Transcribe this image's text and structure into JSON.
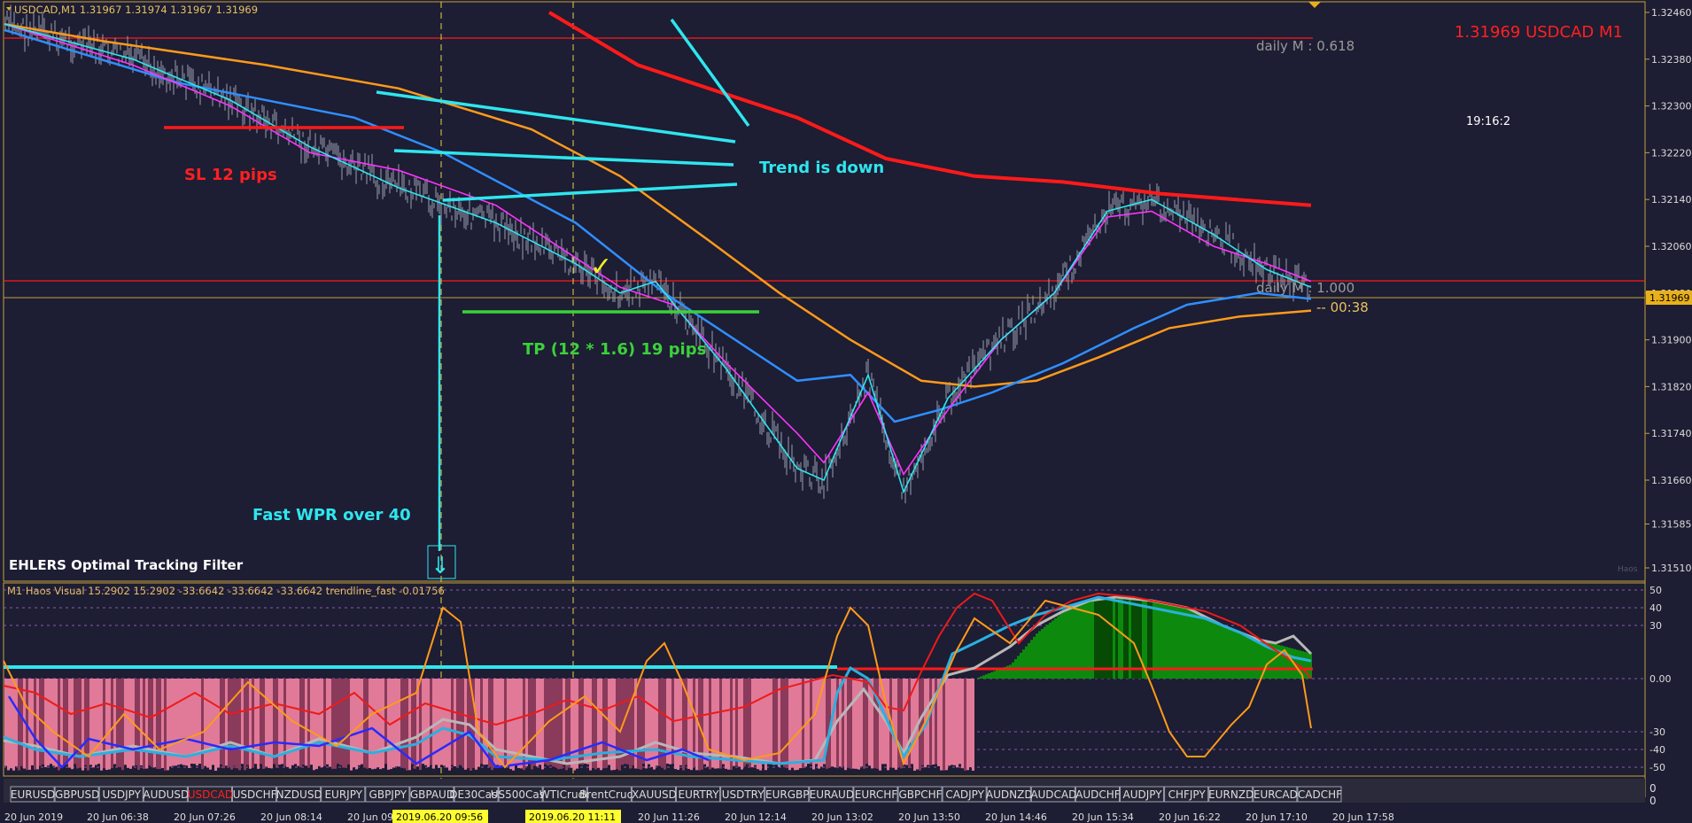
{
  "window": {
    "header": "USDCAD,M1  1.31967 1.31974 1.31967 1.31969",
    "symbol_price": "1.31969 USDCAD M1",
    "clock": "19:16:2"
  },
  "colors": {
    "background": "#1d1d33",
    "frame": "#c8a13b",
    "price_text": "#ff2020",
    "cyan": "#2ee6ee",
    "red_line": "#ff1a1a",
    "orange": "#ff9a1a",
    "blue": "#2f8fff",
    "magenta": "#ff33ff",
    "green_label": "#3bd13b",
    "pink_hist": "#e07a98",
    "green_hist": "#0d8a0d"
  },
  "price_axis": {
    "ticks": [
      "1.32460",
      "1.32380",
      "1.32300",
      "1.32220",
      "1.32140",
      "1.32060",
      "1.31980",
      "1.31900",
      "1.31820",
      "1.31740",
      "1.31660",
      "1.31585",
      "1.31510"
    ],
    "current": "1.31969"
  },
  "annotations": {
    "sl": "SL 12 pips",
    "trend": "Trend is down",
    "tp": "TP (12 * 1.6) 19 pips",
    "wpr": "Fast WPR over 40",
    "checkmark": "✓",
    "ehlers": "EHLERS Optimal Tracking Filter",
    "daily_m": "daily M : 0.618",
    "daily_1": "daily M : 1.000",
    "countdown": "-- 00:38",
    "micro_label": "Haos"
  },
  "indicator": {
    "header": "M1 Haos Visual 15.2902 15.2902 -33.6642 -33.6642 -33.6642  trendline_fast -0.01756",
    "ticks": [
      "50",
      "40",
      "30",
      "0.00",
      "-30",
      "-40",
      "-50"
    ]
  },
  "symbol_tabs": [
    "EURUSD",
    "GBPUSD",
    "USDJPY",
    "AUDUSD",
    "USDCAD",
    "USDCHF",
    "NZDUSD",
    "EURJPY",
    "GBPJPY",
    "GBPAUD",
    "DE30Cash",
    "US500Cash",
    "WTICrude",
    "BrentCrude",
    "XAUUSD",
    "EURTRY",
    "USDTRY",
    "EURGBP",
    "EURAUD",
    "EURCHF",
    "GBPCHF",
    "CADJPY",
    "AUDNZD",
    "AUDCAD",
    "AUDCHF",
    "AUDJPY",
    "CHFJPY",
    "EURNZD",
    "EURCAD",
    "CADCHF"
  ],
  "active_tab": "USDCAD",
  "tab_axis": [
    "0",
    "0"
  ],
  "time_axis": [
    "20 Jun 2019",
    "20 Jun 06:38",
    "20 Jun 07:26",
    "20 Jun 08:14",
    "20 Jun 09",
    "20 Jun 09:56",
    "20 Jun 11:26",
    "20 Jun 12:14",
    "20 Jun 13:02",
    "20 Jun 13:50",
    "20 Jun 14:46",
    "20 Jun 15:34",
    "20 Jun 16:22",
    "20 Jun 17:10",
    "20 Jun 17:58"
  ],
  "time_markers": [
    "2019.06.20 09:56",
    "2019.06.20 11:11"
  ],
  "chart_data": {
    "type": "line",
    "title": "USDCAD,M1  1.31967 1.31974 1.31967 1.31969",
    "ylim": [
      1.3151,
      1.3246
    ],
    "series": [
      {
        "name": "red slow MA",
        "values": [
          [
            620,
            1.3246
          ],
          [
            720,
            1.3237
          ],
          [
            900,
            1.3228
          ],
          [
            1000,
            1.3221
          ],
          [
            1100,
            1.3218
          ],
          [
            1200,
            1.3217
          ],
          [
            1310,
            1.3215
          ],
          [
            1480,
            1.3213
          ]
        ]
      },
      {
        "name": "orange MA",
        "values": [
          [
            5,
            1.3244
          ],
          [
            120,
            1.3241
          ],
          [
            300,
            1.3237
          ],
          [
            450,
            1.3233
          ],
          [
            600,
            1.3226
          ],
          [
            700,
            1.3218
          ],
          [
            800,
            1.3207
          ],
          [
            880,
            1.3198
          ],
          [
            960,
            1.319
          ],
          [
            1040,
            1.3183
          ],
          [
            1100,
            1.3182
          ],
          [
            1170,
            1.3183
          ],
          [
            1240,
            1.3187
          ],
          [
            1320,
            1.3192
          ],
          [
            1400,
            1.3194
          ],
          [
            1480,
            1.3195
          ]
        ]
      },
      {
        "name": "blue MA",
        "values": [
          [
            5,
            1.3243
          ],
          [
            200,
            1.3234
          ],
          [
            400,
            1.3228
          ],
          [
            500,
            1.3222
          ],
          [
            650,
            1.321
          ],
          [
            750,
            1.3198
          ],
          [
            900,
            1.3183
          ],
          [
            960,
            1.3184
          ],
          [
            1010,
            1.3176
          ],
          [
            1060,
            1.3178
          ],
          [
            1120,
            1.3181
          ],
          [
            1200,
            1.3186
          ],
          [
            1280,
            1.3192
          ],
          [
            1340,
            1.3196
          ],
          [
            1420,
            1.3198
          ],
          [
            1480,
            1.3197
          ]
        ]
      },
      {
        "name": "magenta MA",
        "values": [
          [
            5,
            1.3244
          ],
          [
            150,
            1.3237
          ],
          [
            260,
            1.323
          ],
          [
            350,
            1.3222
          ],
          [
            450,
            1.3219
          ],
          [
            560,
            1.3213
          ],
          [
            650,
            1.3204
          ],
          [
            700,
            1.3199
          ],
          [
            760,
            1.3196
          ],
          [
            820,
            1.3186
          ],
          [
            900,
            1.3174
          ],
          [
            930,
            1.3169
          ],
          [
            980,
            1.3181
          ],
          [
            1020,
            1.3167
          ],
          [
            1070,
            1.3178
          ],
          [
            1130,
            1.319
          ],
          [
            1190,
            1.3198
          ],
          [
            1250,
            1.3211
          ],
          [
            1300,
            1.3212
          ],
          [
            1370,
            1.3206
          ],
          [
            1430,
            1.3203
          ],
          [
            1480,
            1.32
          ]
        ]
      },
      {
        "name": "cyan filter",
        "values": [
          [
            5,
            1.3244
          ],
          [
            150,
            1.3238
          ],
          [
            260,
            1.3231
          ],
          [
            350,
            1.3223
          ],
          [
            450,
            1.3216
          ],
          [
            560,
            1.321
          ],
          [
            650,
            1.3203
          ],
          [
            700,
            1.3198
          ],
          [
            740,
            1.32
          ],
          [
            820,
            1.3185
          ],
          [
            900,
            1.3168
          ],
          [
            930,
            1.3166
          ],
          [
            980,
            1.3184
          ],
          [
            1020,
            1.3164
          ],
          [
            1070,
            1.318
          ],
          [
            1130,
            1.319
          ],
          [
            1190,
            1.3198
          ],
          [
            1250,
            1.3212
          ],
          [
            1300,
            1.3214
          ],
          [
            1370,
            1.3208
          ],
          [
            1430,
            1.3202
          ],
          [
            1480,
            1.3199
          ]
        ]
      }
    ]
  }
}
